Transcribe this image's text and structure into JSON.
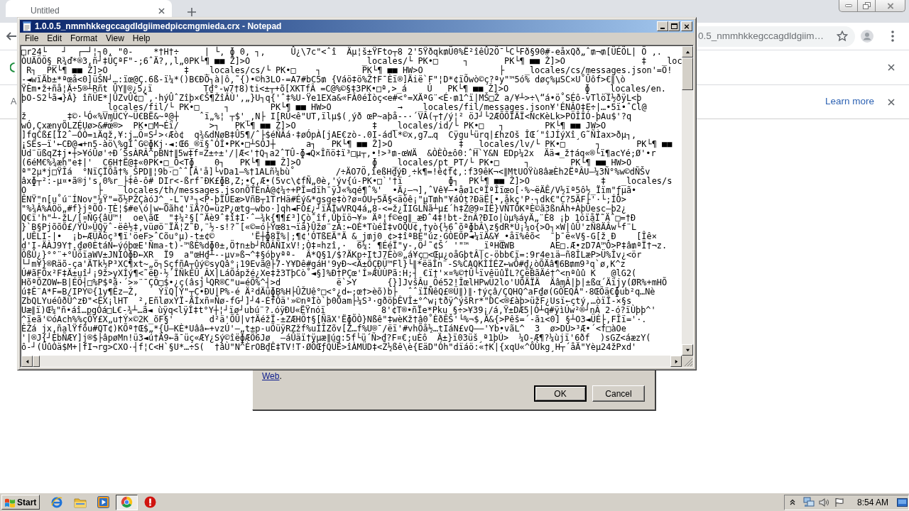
{
  "browser": {
    "tabs": [
      {
        "title": "Untitled",
        "selected": true
      }
    ],
    "address": "0.5_nmmhkkegccagdldgiim…",
    "infobars": [
      {
        "kind": "status"
      },
      {
        "kind": "message",
        "text": "A",
        "link": "Learn more"
      }
    ]
  },
  "dialog": {
    "link": "Web",
    "text_after": ".",
    "buttons": [
      {
        "label": "OK",
        "default": true
      },
      {
        "label": "Cancel",
        "default": false
      }
    ]
  },
  "notepad": {
    "title": "1.0.0.5_nmmhkkegccagdldgiimedpiccmgmieda.crx - Notepad",
    "menu": [
      "File",
      "Edit",
      "Format",
      "View",
      "Help"
    ],
    "lines": [
      "□r24└   ┘  ┌─┘¦┐0, \"0-    *†H†÷     | └, ɸ 0, ┐,     Û¿\\7c\"<ˆî  Äµ¦š±ŸFto┬8 2'5Ÿðqk₥Ü0%Ë²îêÛ2Ö¯└C└Fð§90#-eåxQð„ˆ₥¬₥[ÜÉÖL| Ö ,.",
      "ÒUÄÖÖ§_R¾ď*®3,ñ┘‡ÜÇªF\"-;6ˆÄ?,,l„0PK└¶ ■■ Ž]>O                      _locales/└ PK•□     ┐       PK└¶ ■■ Ž]>O               ‡   _loc",
      " R┐  PK└¶ ■■ Ž]>O               ‡   _locales/cs/└ PK•□    ┐        PK└¶ ■■ HW>O               ├    _locales/cs/messages.json'=O!",
      "-◄wïÄb±*ªœå<0]üŠN┘…:ïœ@Ç.6ß-ï¼*()B€ÐÒ┐à|ô,˜{)•©h3LO-=A7#bC5₥ {Váö‡ö%Ž†F¯Èï®]Äië`F\"¦D*¢ïÕwò©ç?ªy\"™5ó% døç%µSC×U˚Ûôf>€∥\\ò",
      "ŸÈm•ž+ñå¦Ä÷5®┴Rñt ÛY∥®¿5¿ï          T₫°-w7†8)ti<±┬+õ[XKTfÂ =C@%©§‡3PK•□ª,>_á    Ú   PK└¶ ■■ Ž]>O               ɸ   _locales/en.",
      "þO-S2└ã◄}Â} îñÜE*|ÛZvÛ¢□ˆ,·hýÛˆZîþ×€Š¶ŽîÂÙ',„}U┐q{'ˆ‡%U-Ÿe1EXa&«FÂ0éÌòç<e#<°=XÄªG¨<É·₥1^ï|MŠ□Ž a/¥┴>÷\\“á•ö˚SÉô-vTlöI½ðÿL<þ",
      "                _locales/fil/└ PK•□     ┐        PK└¶ ■■ HW>O             →   _locales/fil/messages.json¥'ÉNÂO‡E÷|…•5ï•ˆCl@",
      "ž        ‡©·└Ó«%VɱÜCÝ~Ü€BË&~ª@┼    ˆï„%¦ ┬$'_,N├ I[RÛ<ê\"UT,ïlµ$(¸ýð œP~aþå--·´VÂ(┬†/ý¦² öJ┘└2ÆÕÕÏÄÏ<NcKèLk>PÖÎÎÓ-þAu$'?q",
      "wÓ,ÇxænyÕLZÉUø>&#œ®>  PK•□M¬Éï/      >┐   PK└¶ ■■ Ž]>O               ‡   _locales/id/└ PK•□   ┐        PK└¶ ■■ JW>O",
      "]fqCß£[Ì2ˆ—ÓÒ=ıÄqž,¥:j…Ö¤S┘>‹Æò¢  q¾&dNøB‡Û5¶/ˆ├$éÑÂá·‡øÓpÀ[jAE€zò-.0I-ádl*©x,g7…q  Cÿgu└ürq|£hzOš ÎŒ´\"îJÍýXî¸G˜ÑÌax>ðµ┐,",
      "¡SÈs—ï'←CÐ@◄+n5-àö\\%gÎˆG©ɸKj·◄:Œ6_®ï§ˆÓÎ•PK•□┴SÓJ┼      a┐   PK└¶ ■■ Ž]>O             ‡  _locales/lv/└ PK•□      ┐       PK└¶ ■■",
      "Üd¨üßqZ‡j•┼>¥óÛø'÷Ð´ŠsÀRÂ^pBN†∥5w‡f¤Z±÷±'/|Æ<'†Q┐a2ˆTÛ-ɸ◄Q×Îñö‡ï³□µ┬,•!>³₥-œWÄ  &ÒÈÒ±ô0:ˆH`Y&N EDp¼2x  Ää◄_ž†áq«®└ï¶acYé;Ø'•r",
      "(6éM€%¾æh\"e‡|'  C6H†Ë@‡«0PK•□_Ô<Tɸ    0┐   PK└¶ ■■ Ž]>O              ɸ   _locales/pt_PT/└ PK•□     ┐        PK└¶ ■■ HW>O",
      "ª\"2µ*j□ŸÎá  °NïÇÏÕå†%¸ŠPD∥¦9b·□ˆˆ[Â'å]└vDa1—%†1ALñ¼bù˚        /÷ÄO7Ö,îeßH₫ýÐ¸÷k¶=!ê¢f¢,:f39êK¬<∥MtUOŸù8âæÈh2ËªÂU—¼3Ñ°%w©dÑŠv",
      "âxɸ┬²:-µ¤•ã®j's,0%r_├‡ê-ô# DIr<-ßrf¯ÐK£ɸB,Z;•Ç,Æ•(5vc\\¢fÑ„0è,'ýv{ú-PK•□`'†ï         ɸ┐  PK└¶ ■■ Ž]>O              ‡   _locales/s",
      "O              ├   _locales/th/messages.jsonÕTÈnÂ@¢¼÷+PÎ=dïh¯ÿJ«%qé¶ˆ%'  •Ä¿—¬],ˆVê¥—•åø1cªÏªÎïœo[·%~ëÄÊ/V½ïª5ô½_Ïïm\"ƒµã•",
      "ÊNŸ\"n[u˚ú¨ÍNov\"¼Ÿ\"=õ½PŽÇàóJ^_-L¯V³┐<P-þÏÜEæ>VñB┬1TrHä#Éý&*gsge‡ò?ø¤ÒU┬5Ä§<äòê¡\"µT₥h\"¥áÓt?ÐäË[•,åkç'P·┐dk€\"C?5ÄF├'·└;ÍÒ>",
      "\"%¾Â%ÂÖö„#f}jªÕÒ·TÈ¦$#e\\ó|w←Õãh¢'ïÄ?Ó=üzP¿œtg—wbo·]qh◄FÓ£¿┘ïÄÏwVRQ4á„8-<=ž¿ÏIGLÑã┴µ£´h‡Ž@9¤ÌË}VÑTÔKªÈ©ã3ßnÂh+ÀþÜesc—þ2¿",
      "Q€ï'h\"┴-žL/[¤ÑG{âÜ™!  oe\\ãŒ  \"‡¼²§[˜Äè9ˆ‡î‡I·ˆ—¾k{¶¶£³]Çò¯îf,Ûþïö¬¥» Äª¦f©eg∥_æÐˆ4‡!bt-žnÂ?ÐIo|ùµ%áyÄ„¨È8 ¡þ 1óïåÏ˜Äˆ□=†Ð",
      "}`B§PjõõÕ£/ŸÛ»ÛQÿˆ-ëê½‡,vüøö¨ÏÄ¦Z˜Ð,¨½-s!?˜[«©=ó├Ÿœ8ı¬ïå}Ûžø¨zÂ:←OÈ*TùéÎ‡vOQU¢,†yò{½6ˆõªɸbÂ\\z§dR*Ù¡¼o{>O┐×W|ûÛ'zÑ8ÄÂw└f¨L",
      ",UÊLI-|•  ¡b←ÆÜÄöç³¶ï'öeF>ˆCõu°µ)-t±¢©       'Ë┼ɸ8Ï%|;¶¢'ÓTßEÄ\"Ä &_j₥j0 ¢>‡îªBÈ\"úz·GÒEÕP◄¼ïÄ&¥_•åï%êõ<  ¯þ¯ë«V§-G[ž¸Ð    [Îê×",
      "d'I-ÄÀJ9Y†.₫ø0ÈtáN←ýóþœE'Ñma-t)-™ßÈ%dɸ0±,Ö†n±b┘RÖÂÑIxV!;Ò‡¤hzî,·  6¼: ¶ÉéÏ\"y-,Ö┘˜¢Š´ '\"™  _ïªHŒWB       AE□.Æ•zD7A™Ò>P‡â₥ªÏ†¬z.",
      "ÕßÛ¿}°°¨+°ÛöïaWV±JNIÒɸÐ←XR  Ï9  a\"œH₫┴--µv»ß¬^‡§óþyªª-  Â*Q§1/$?ÄKp÷ItJ7Êò®„á¥ç□<Œµ¿oåGþtÂ|c-öbb€ï=:9r4eıä—ñ8ÎLæP>Ü%Îv¿<ör",
      "└┘m¥}®Räõ-ça'ÄTk½P³XC¶xt~„ö┐SçfñA┬ûý©syQâ°¡19Evã@├7-Y¥Dê#gáH'9yÐ~<Ä±ÕÇÐÜ™Fl}└∥*ëäÎn¨-S%CAQKÌÍÉZ←wÔ#₫¿òÕÄâ¶6B₥m9³q`ø,K^z",
      "Ú#ãFÕx²F‡Ä±uî┘¡9ž>yXÍý¶<˜ëÐ·½´ÎÑkÉÛ¸ÂX|LáÕápžé¿Xe‡ž3TþCò˚◄§]%Ð†PÇœ'Í»ÆÙÙPã:H;┤ €ï†'×¤%©†Û└ïvêüûÏL?ÇëBãÄé†^<nªûû K   @lG2(",
      "HõªÕZOW←B|ÉÖ┤□%P$ªã·´>»¨¯ÇÖ□$•¿ç(âsj└QR®C\"u=éÕ%^┤>d           ë`>Y      {}]JvšÂu¸Öé52!ÎœlHPwÜ2lo'UÕÄÏÄ  ÄâɱÂ|þ|±ßα´Äïjy(ØR%+mHÕ",
      "ú‡Ê¨A*F=B/IPY©{1y¶Êz—Ž,    ÝïQ|Ý\"┬C•ÐU|P%-é Ä²dÄüɸB%H├ÛŽUê°□<°¿d←;œ†>èõ)b├  ˆˆïÏÑêQ£®Ü∥)∥·†ýçâ/ÇQHQ^aF₫ø(GÒEQÂ\"·8ŒÕä€ɸub²q…Nè",
      "ZbQLYuéûðÛ^zÐ\"<ÊX¡lHT  ²,EñløxÝÏ-ÄÍxñ¤Ñø-fG┘]┘4-ÉfÔä'»©nªÌò`þ0Õam├¼S³·gðöþÊVÎ±°^w¡tðÿ^ýšRr*\"DC<®£àþ>üžF¿Usï←çtý,…òïÎ-×§s",
      "Uæ∥ï)Œ¼\"ñ•áî…pgÓá□L€-¾┴…ã◄ ùÿq<lÿÍ‡t°Y┼¦┘ïø┘ubú¨?.óÿÐU«ËŸnóï           8'¢T®•ñÏe*Pku §÷>¥39¡/á,Ÿ±DÆ5|Ó┴q#ÿìÚw²®┘nÂ 2-ó?ïÙþþ^'",
      "^ïeã'©óAch%%çÖÝ£X„u†Ý×©2K_õF§'       d²ä'ÕÛ|v†ÄéžÏ-±ZÆHÖ†§[ÑãX'ËɸÕÒ}Nßê\"‡wèKž†â0˚ÈðÊŠ'└%¬$,Ä&{>Pêš=´-ãı<0] §┴O3◄ÜÉ├,FÎï='·.",
      "ÈŽá jx,ñalŸfõu#QT¢)KÕª†Œ$„*{Û—KÈ*Uââ←+vzÚ'—„t±p-uÕüÿRZžf%uÎÎZõv[Z…f%U®¯/ëï'#vhÕå½…tIáN£vQ——'Yb•vãL^  3  ø>DÙ>³Æ•´<f□àOe",
      "'|®J{┘ÉbÑÆY]j®$├âpøMn!ü3◄ú†Ä9←ã¯üç«ÆY¿Sý©îëɸÆÕ6Jø  —áÛäï†ÿµæ∥úg:5f└ü´Ñ>₫?F¤€;uÈô  Ä±}ï03üš¸ª1þÚ>  ¼O-Æ¶?¼ùjï'6ðf  )sGZ<áæzY(",
      "ô-┘(ÛûÒä$M+|fI¬rg>CXO·┤f¦C<H`§U*…÷S(  †âÙ\"N^ÈrOB₫Ê‡TV!T·ØÖŒƒQÜÊ>îÀMÜD‡<Z½ßê\\è{EäD\"Óh\"dïáö:«†K|{xqU«^ÔÙkg¸H┬´åÄ\"Yèµ24žPxd'"
    ]
  },
  "taskbar": {
    "start": "Start",
    "buttons": [
      {
        "selected": false
      },
      {
        "selected": false
      },
      {
        "selected": false
      },
      {
        "selected": true
      },
      {
        "selected": false
      }
    ],
    "clock": "8:54 AM"
  }
}
